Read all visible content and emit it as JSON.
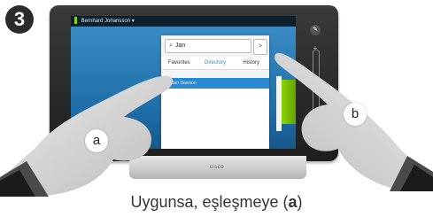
{
  "step": {
    "number": "3"
  },
  "device": {
    "user_name": "Bernhard Johansson",
    "search_value": "Jan",
    "go_label": ">",
    "tabs": [
      {
        "label": "Favorites",
        "active": false
      },
      {
        "label": "Directory",
        "active": true
      },
      {
        "label": "History",
        "active": false
      }
    ],
    "result_name": "Jan Dawson",
    "brand": "cisco"
  },
  "hands": {
    "left_label": "a",
    "right_label": "b"
  },
  "caption": {
    "prefix": "Uygunsa, eşleşmeye (",
    "bold": "a",
    "suffix": ")"
  },
  "colors": {
    "accent": "#2a8ad1",
    "presence": "#8ed400"
  }
}
